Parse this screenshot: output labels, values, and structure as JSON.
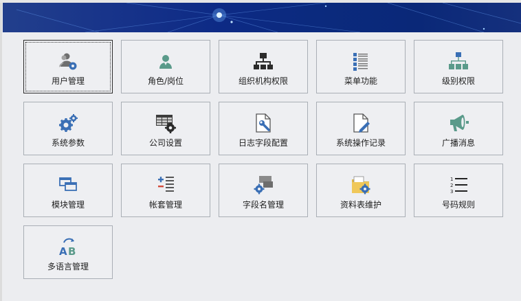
{
  "modules": [
    {
      "label": "用户管理",
      "icon": "users-gear-icon",
      "selected": true
    },
    {
      "label": "角色/岗位",
      "icon": "person-icon"
    },
    {
      "label": "组织机构权限",
      "icon": "org-chart-icon"
    },
    {
      "label": "菜单功能",
      "icon": "menu-list-icon"
    },
    {
      "label": "级别权限",
      "icon": "hierarchy-icon"
    },
    {
      "label": "系统参数",
      "icon": "gears-icon"
    },
    {
      "label": "公司设置",
      "icon": "grid-gear-icon"
    },
    {
      "label": "日志字段配置",
      "icon": "document-wrench-icon"
    },
    {
      "label": "系统操作记录",
      "icon": "document-pen-icon"
    },
    {
      "label": "广播消息",
      "icon": "megaphone-icon"
    },
    {
      "label": "模块管理",
      "icon": "windows-icon"
    },
    {
      "label": "帐套管理",
      "icon": "plus-minus-list-icon"
    },
    {
      "label": "字段名管理",
      "icon": "fields-gear-icon"
    },
    {
      "label": "资料表维护",
      "icon": "folder-gear-icon"
    },
    {
      "label": "号码规则",
      "icon": "numbered-list-icon"
    },
    {
      "label": "多语言管理",
      "icon": "language-ab-icon"
    }
  ],
  "colors": {
    "banner": "#0d2a85",
    "icon_blue": "#3a6fb5",
    "icon_green": "#5a9a8a",
    "icon_dark": "#2b2b2b"
  }
}
